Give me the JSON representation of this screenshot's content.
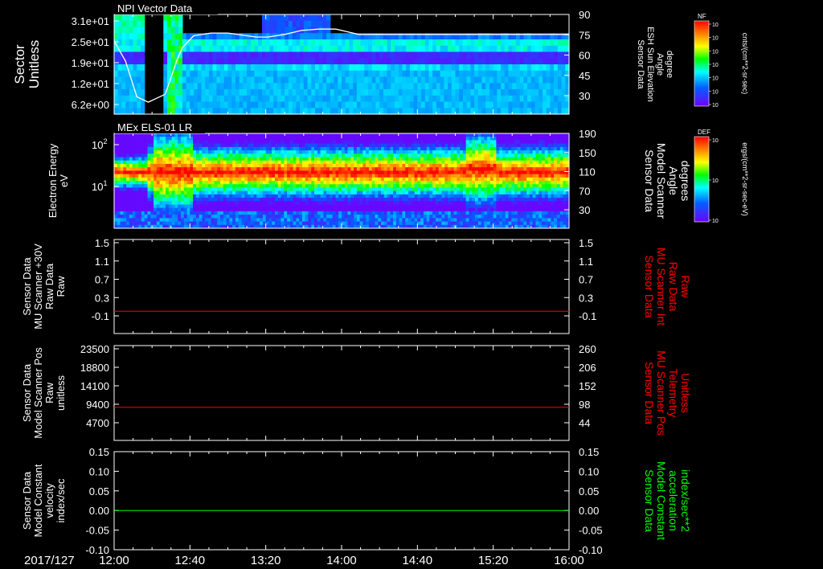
{
  "time_axis": {
    "date_label": "2017/127",
    "tick_labels": [
      "12:00",
      "12:40",
      "13:20",
      "14:00",
      "14:40",
      "15:20",
      "16:00"
    ],
    "start_hours": 12.0,
    "end_hours": 16.0
  },
  "colors": {
    "background": "#000000",
    "axes": "#ffffff",
    "trace_white": "#ffffff",
    "trace_red": "#ff0000",
    "trace_green": "#00ff00",
    "label_red": "#ff0000",
    "label_green": "#00ff00"
  },
  "colorbars": [
    {
      "tag": "NF",
      "exponents": [
        "10",
        "10",
        "10",
        "10",
        "10",
        "10",
        "10"
      ],
      "unit_label": "cnts/(cm**2-sr-sec)"
    },
    {
      "tag": "DEF",
      "exponents": [
        "10",
        "10",
        "10"
      ],
      "unit_label": "ergs/(cm**2-sr-sec-eV)"
    }
  ],
  "chart_data": [
    {
      "type": "heatmap",
      "title": "NPI Vector Data",
      "ylabel": [
        "Sector",
        "Unitless"
      ],
      "ytick_labels": [
        "3.1e+01",
        "2.5e+01",
        "1.9e+01",
        "1.2e+01",
        "6.2e+00"
      ],
      "y2label": [
        "Sensor Data",
        "ESH Sun Elevation",
        "Angle",
        "degree"
      ],
      "y2tick_labels": [
        "90",
        "75",
        "60",
        "45",
        "30"
      ],
      "y2lim": [
        15,
        90
      ],
      "overlay_series": {
        "name": "ESH Sun Elevation Angle",
        "color": "#ffffff",
        "x_hours": [
          12.0,
          12.1,
          12.2,
          12.3,
          12.45,
          12.55,
          12.6,
          12.7,
          12.85,
          13.0,
          13.25,
          13.35,
          13.5,
          13.65,
          13.8,
          13.95,
          14.05,
          14.15,
          14.5,
          15.0,
          16.0
        ],
        "y": [
          70,
          55,
          28,
          24,
          30,
          55,
          65,
          74,
          76,
          76,
          73,
          73,
          75,
          78,
          79,
          79,
          77,
          75,
          75,
          75,
          75
        ]
      }
    },
    {
      "type": "heatmap",
      "title": "MEx ELS-01 LR",
      "ylabel": [
        "Electron Energy",
        "eV"
      ],
      "ytick_labels": [
        "10^2",
        "10^1"
      ],
      "y2label": [
        "Sensor Data",
        "Model Scanner",
        "Angle",
        "degrees"
      ],
      "y2tick_labels": [
        "190",
        "150",
        "110",
        "70",
        "30"
      ]
    },
    {
      "type": "line",
      "ylabel": [
        "Sensor Data",
        "MU Scanner +30V",
        "Raw Data",
        "Raw"
      ],
      "ytick_labels": [
        "1.5",
        "1.1",
        "0.7",
        "0.3",
        "-0.1"
      ],
      "ylim": [
        -0.4,
        1.5
      ],
      "y2label": [
        "Sensor Data",
        "MU Scanner Int",
        "Raw Data",
        "Raw"
      ],
      "y2tick_labels": [
        "1.5",
        "1.1",
        "0.7",
        "0.3",
        "-0.1"
      ],
      "series": [
        {
          "color": "#ff0000",
          "x_hours": [
            12.0,
            16.0
          ],
          "y": [
            0.05,
            0.05
          ]
        }
      ]
    },
    {
      "type": "line",
      "ylabel": [
        "Sensor Data",
        "Model Scanner Pos",
        "Raw",
        "unitless"
      ],
      "ytick_labels": [
        "23500",
        "18800",
        "14100",
        "9400",
        "4700"
      ],
      "ylim": [
        0,
        23500
      ],
      "y2label": [
        "Sensor Data",
        "MU Scanner Pos",
        "Telemetry",
        "Unitless"
      ],
      "y2tick_labels": [
        "260",
        "206",
        "152",
        "98",
        "44"
      ],
      "series": [
        {
          "color": "#ff0000",
          "x_hours": [
            12.0,
            16.0
          ],
          "y": [
            8200,
            8200
          ]
        }
      ]
    },
    {
      "type": "line",
      "ylabel": [
        "Sensor Data",
        "Model Constant",
        "velocity",
        "index/sec"
      ],
      "ytick_labels": [
        "0.15",
        "0.10",
        "0.05",
        "0.00",
        "-0.05",
        "-0.10"
      ],
      "ylim": [
        -0.1,
        0.15
      ],
      "y2label": [
        "Sensor Data",
        "Model Constant",
        "acceleration",
        "index/sec**2"
      ],
      "y2tick_labels": [
        "0.15",
        "0.10",
        "0.05",
        "0.00",
        "-0.05",
        "-0.10"
      ],
      "series": [
        {
          "color": "#00ff00",
          "x_hours": [
            12.0,
            16.0
          ],
          "y": [
            0.0,
            0.0
          ]
        }
      ]
    }
  ]
}
